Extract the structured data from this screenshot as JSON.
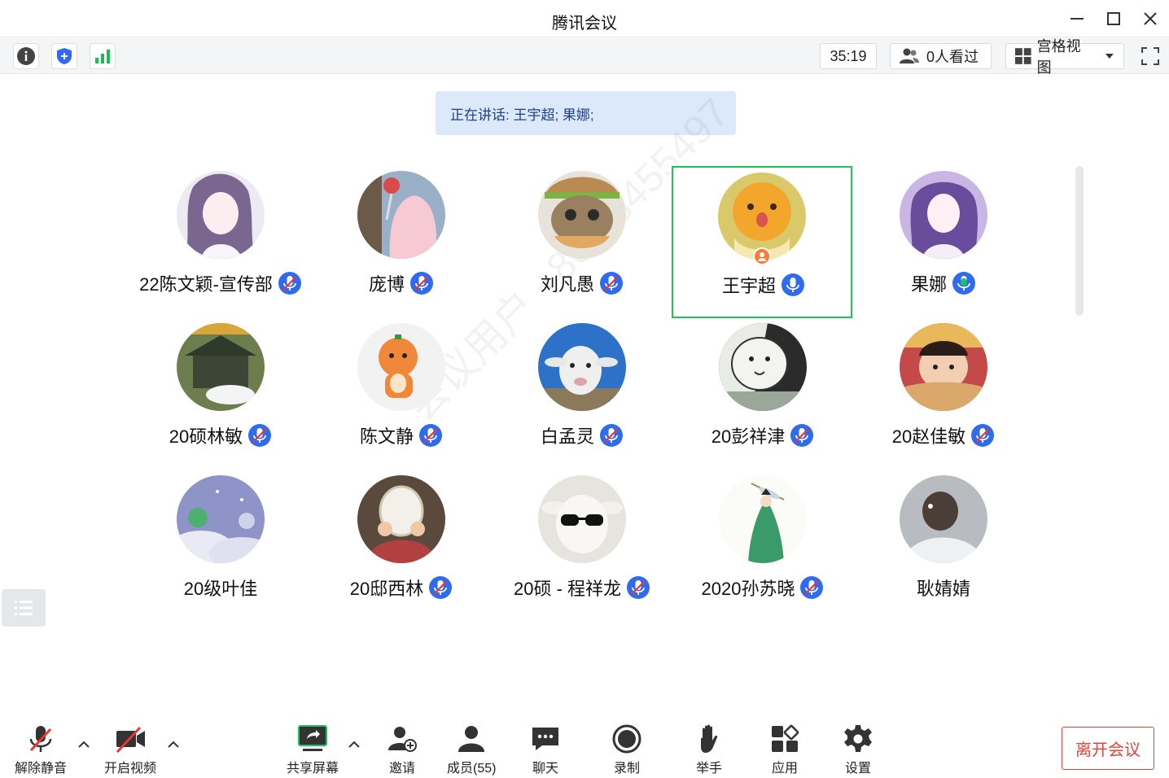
{
  "window": {
    "title": "腾讯会议"
  },
  "toolbar": {
    "timer": "35:19",
    "viewers": "0人看过",
    "view_mode": "宫格视图"
  },
  "banner": {
    "text": "正在讲话: 王宇超; 果娜;"
  },
  "watermark": "会议用户 +86 13455497",
  "participants": [
    {
      "name": "22陈文颖-宣传部",
      "mic": "muted"
    },
    {
      "name": "庞博",
      "mic": "muted"
    },
    {
      "name": "刘凡愚",
      "mic": "muted"
    },
    {
      "name": "王宇超",
      "mic": "on",
      "active": true,
      "host": true
    },
    {
      "name": "果娜",
      "mic": "speaking"
    },
    {
      "name": "20硕林敏",
      "mic": "muted"
    },
    {
      "name": "陈文静",
      "mic": "muted"
    },
    {
      "name": "白孟灵",
      "mic": "muted"
    },
    {
      "name": "20彭祥津",
      "mic": "muted"
    },
    {
      "name": "20赵佳敏",
      "mic": "muted"
    },
    {
      "name": "20级叶佳",
      "mic": "none"
    },
    {
      "name": "20邸西林",
      "mic": "muted"
    },
    {
      "name": "20硕 - 程祥龙",
      "mic": "muted"
    },
    {
      "name": "2020孙苏晓",
      "mic": "muted"
    },
    {
      "name": "耿婧婧",
      "mic": "none"
    }
  ],
  "bottom": {
    "unmute": "解除静音",
    "video": "开启视频",
    "share": "共享屏幕",
    "invite": "邀请",
    "members": "成员(55)",
    "chat": "聊天",
    "record": "录制",
    "raise_hand": "举手",
    "apps": "应用",
    "settings": "设置",
    "leave": "离开会议"
  },
  "colors": {
    "accent": "#2f6bf0",
    "active_border": "#22c25a",
    "leave": "#e0443c",
    "banner_bg": "#dce9fb"
  }
}
